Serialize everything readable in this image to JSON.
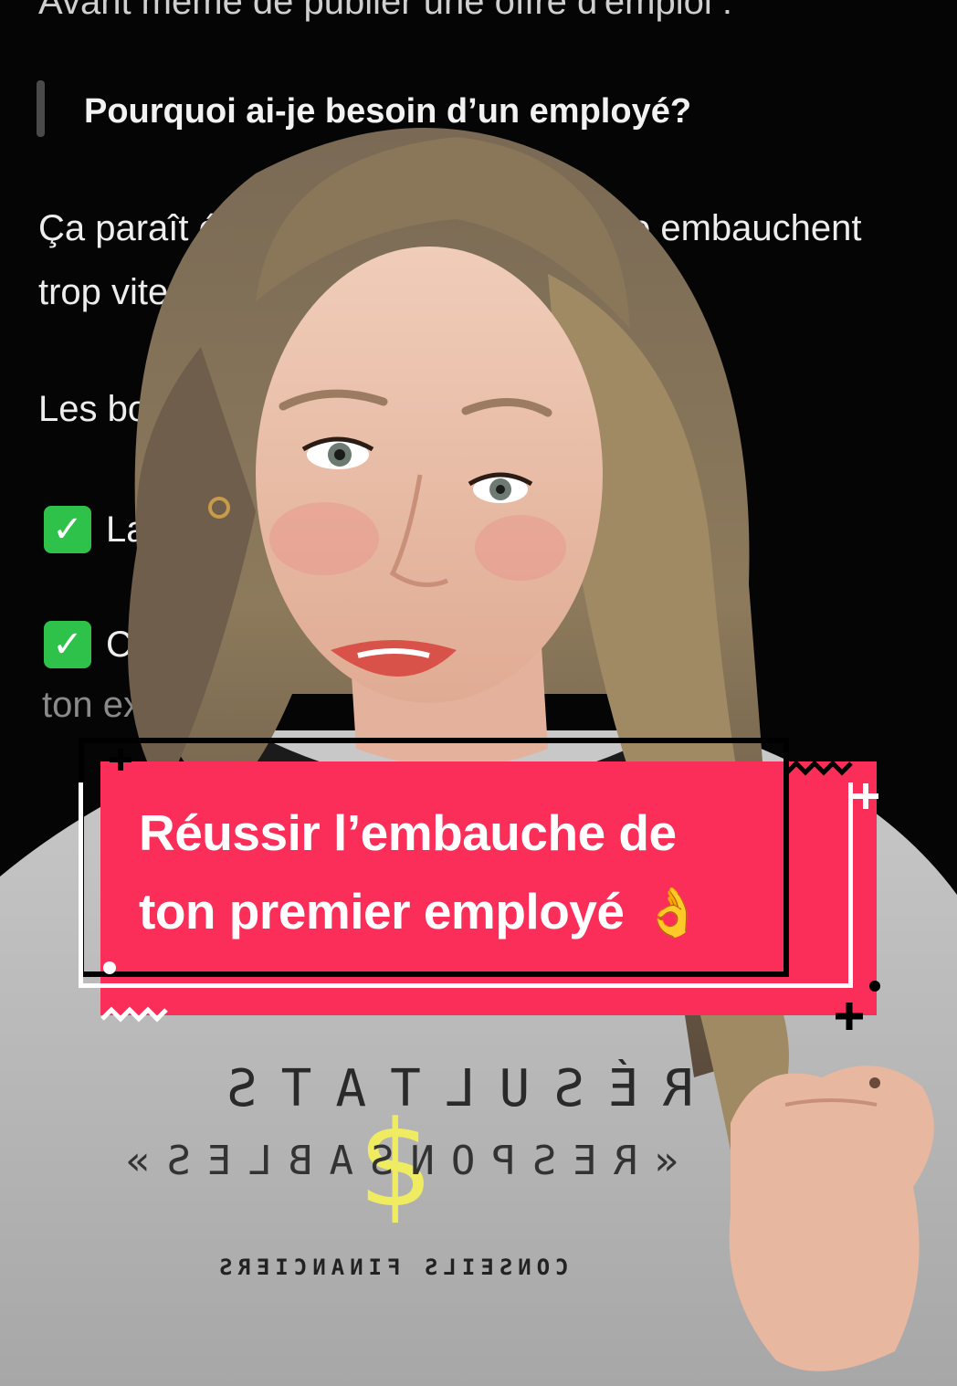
{
  "document": {
    "top_line": "Avant même de publier une offre d'emploi :",
    "heading": "Pourquoi ai-je besoin d’un employé?",
    "paragraph_line_1_start": "Ça paraît év",
    "paragraph_line_1_end": "o embauchent",
    "paragraph_line_2": "trop vite.",
    "line_3": "Les bon",
    "check_1_text": "La",
    "check_2_text": "C",
    "line_4": "ton exp"
  },
  "shirt": {
    "line_1": "RÉSULTATS",
    "line_2": "«RESPONSABLES»",
    "line_3": "CONSEILS FINANCIERS"
  },
  "title_card": {
    "line_1": "Réussir l’embauche de",
    "line_2": "ton premier employé",
    "emoji": "👌"
  },
  "colors": {
    "card": "#fb2e59",
    "check": "#2ec24a",
    "background": "#050505"
  }
}
